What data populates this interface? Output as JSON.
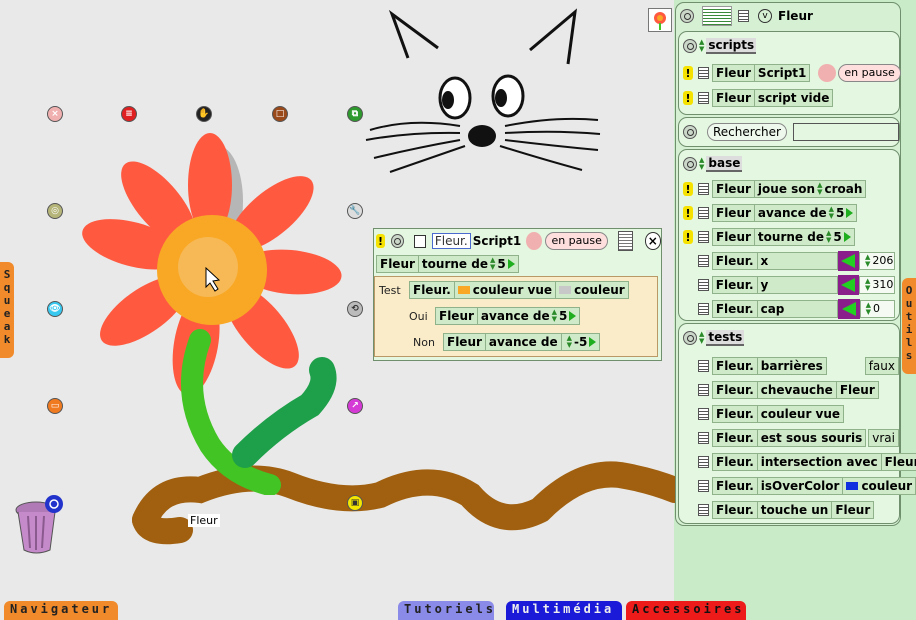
{
  "world": {
    "sketch_name": "Fleur",
    "colors": {
      "petal": "#ff5a40",
      "center": "#f9a825",
      "stem": "#43c425",
      "ground": "#a0600f",
      "background": "#e9e9e9"
    }
  },
  "halo_icons": [
    "close-icon",
    "menu-icon",
    "grab-icon",
    "drag-icon",
    "duplicate-icon",
    "orientation-icon",
    "eye-icon",
    "wrench-icon",
    "collapse-icon",
    "rotate-icon",
    "resize-icon",
    "target-icon"
  ],
  "trash": {
    "icon": "trash-icon"
  },
  "tabs": {
    "navigateur": "Navigateur",
    "tutoriels": "Tutoriels",
    "multimedia": "Multimédia",
    "accessoires": "Accessoires",
    "squeak": [
      "S",
      "q",
      "u",
      "e",
      "a",
      "k"
    ],
    "outils": [
      "O",
      "u",
      "t",
      "i",
      "l",
      "s"
    ]
  },
  "script_editor": {
    "object": "Fleur.",
    "name": "Script1",
    "status": "en pause",
    "line1": {
      "obj": "Fleur",
      "cmd": "tourne de",
      "value": "5"
    },
    "test": {
      "label": "Test",
      "obj": "Fleur.",
      "cond": "couleur vue",
      "cond2": "couleur",
      "oui_label": "Oui",
      "oui_obj": "Fleur",
      "oui_cmd": "avance de",
      "oui_value": "5",
      "non_label": "Non",
      "non_obj": "Fleur",
      "non_cmd": "avance de",
      "non_value": "-5"
    }
  },
  "viewer": {
    "header": {
      "v": "v",
      "title": "Fleur"
    },
    "scripts": {
      "category": "scripts",
      "rows": [
        {
          "obj": "Fleur",
          "name": "Script1",
          "status": "en pause"
        },
        {
          "obj": "Fleur",
          "name": "script vide"
        }
      ]
    },
    "search": {
      "label": "Rechercher",
      "value": ""
    },
    "base": {
      "category": "base",
      "commands": [
        {
          "obj": "Fleur",
          "cmd": "joue son",
          "arg": "croah"
        },
        {
          "obj": "Fleur",
          "cmd": "avance de",
          "arg": "5"
        },
        {
          "obj": "Fleur",
          "cmd": "tourne de",
          "arg": "5"
        }
      ],
      "vars": [
        {
          "obj": "Fleur.",
          "name": "x",
          "value": "206"
        },
        {
          "obj": "Fleur.",
          "name": "y",
          "value": "310"
        },
        {
          "obj": "Fleur.",
          "name": "cap",
          "value": "0"
        }
      ]
    },
    "tests": {
      "category": "tests",
      "rows": [
        {
          "obj": "Fleur.",
          "name": "barrières",
          "arg": "faux"
        },
        {
          "obj": "Fleur.",
          "name": "chevauche",
          "arg": "Fleur"
        },
        {
          "obj": "Fleur.",
          "name": "couleur vue",
          "arg": ""
        },
        {
          "obj": "Fleur.",
          "name": "est sous souris",
          "arg": "vrai"
        },
        {
          "obj": "Fleur.",
          "name": "intersection avec",
          "arg": "Fleur"
        },
        {
          "obj": "Fleur.",
          "name": "isOverColor",
          "arg": "couleur"
        },
        {
          "obj": "Fleur.",
          "name": "touche un",
          "arg": "Fleur"
        }
      ]
    }
  }
}
